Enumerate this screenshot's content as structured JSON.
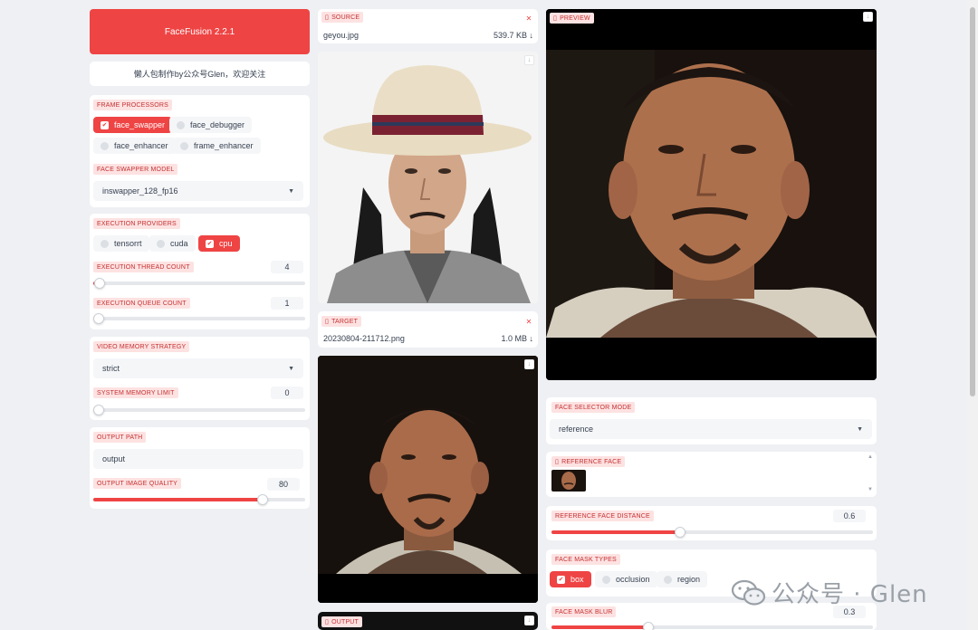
{
  "app": {
    "title": "FaceFusion 2.2.1",
    "credit": "懒人包制作by公众号Glen，欢迎关注"
  },
  "frame_processors": {
    "label": "FRAME PROCESSORS",
    "options": [
      {
        "label": "face_swapper",
        "checked": true
      },
      {
        "label": "face_debugger",
        "checked": false
      },
      {
        "label": "face_enhancer",
        "checked": false
      },
      {
        "label": "frame_enhancer",
        "checked": false
      }
    ]
  },
  "face_swapper_model": {
    "label": "FACE SWAPPER MODEL",
    "value": "inswapper_128_fp16"
  },
  "execution_providers": {
    "label": "EXECUTION PROVIDERS",
    "options": [
      {
        "label": "tensorrt",
        "checked": false
      },
      {
        "label": "cuda",
        "checked": false
      },
      {
        "label": "cpu",
        "checked": true
      }
    ]
  },
  "execution_thread_count": {
    "label": "EXECUTION THREAD COUNT",
    "value": "4",
    "fraction": 0.03
  },
  "execution_queue_count": {
    "label": "EXECUTION QUEUE COUNT",
    "value": "1",
    "fraction": 0.0
  },
  "video_memory_strategy": {
    "label": "VIDEO MEMORY STRATEGY",
    "value": "strict"
  },
  "system_memory_limit": {
    "label": "SYSTEM MEMORY LIMIT",
    "value": "0",
    "fraction": 0.0
  },
  "output_path": {
    "label": "OUTPUT PATH",
    "value": "output"
  },
  "output_image_quality": {
    "label": "OUTPUT IMAGE QUALITY",
    "value": "80",
    "fraction": 0.8
  },
  "source": {
    "label": "SOURCE",
    "filename": "geyou.jpg",
    "size": "539.7 KB ↓"
  },
  "target": {
    "label": "TARGET",
    "filename": "20230804-211712.png",
    "size": "1.0 MB ↓"
  },
  "output": {
    "label": "OUTPUT"
  },
  "preview": {
    "label": "PREVIEW"
  },
  "face_selector_mode": {
    "label": "FACE SELECTOR MODE",
    "value": "reference"
  },
  "reference_face": {
    "label": "REFERENCE FACE"
  },
  "reference_face_distance": {
    "label": "REFERENCE FACE DISTANCE",
    "value": "0.6",
    "fraction": 0.4
  },
  "face_mask_types": {
    "label": "FACE MASK TYPES",
    "options": [
      {
        "label": "box",
        "checked": true
      },
      {
        "label": "occlusion",
        "checked": false
      },
      {
        "label": "region",
        "checked": false
      }
    ]
  },
  "face_mask_blur": {
    "label": "FACE MASK BLUR",
    "value": "0.3",
    "fraction": 0.3
  },
  "watermark": {
    "text": "公众号 · Glen"
  },
  "colors": {
    "accent": "#ef4444",
    "tag_bg": "#fde2e2",
    "tag_text": "#c53030"
  }
}
